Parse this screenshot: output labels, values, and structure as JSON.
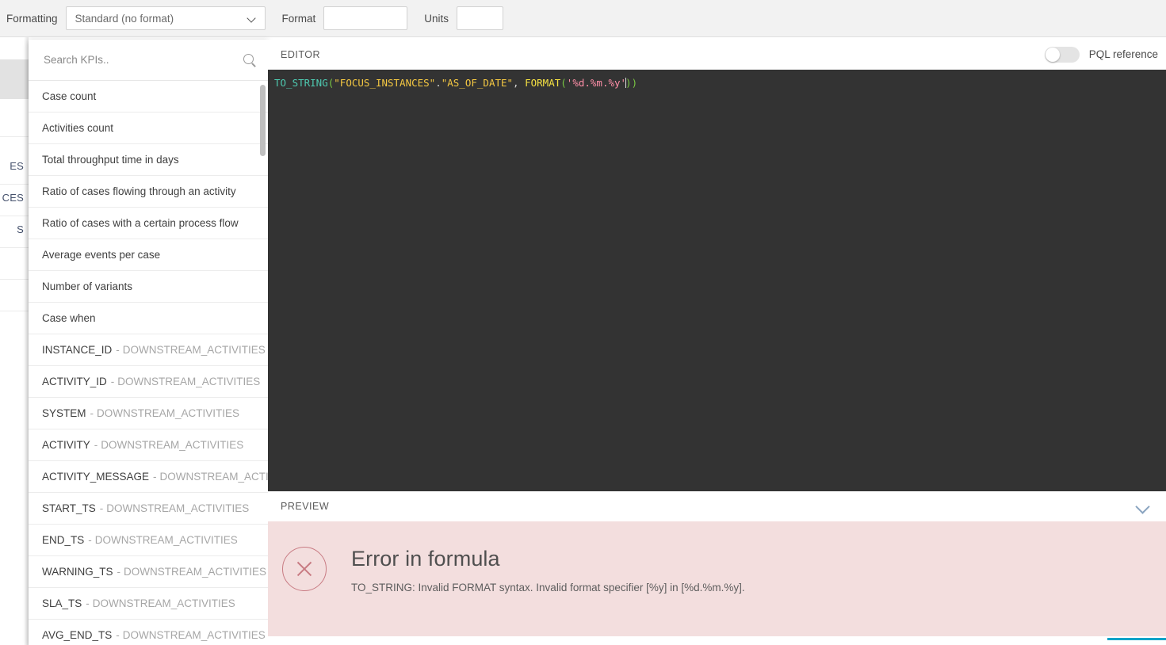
{
  "toolbar": {
    "formatting_label": "Formatting",
    "format_select_value": "Standard (no format)",
    "format_label": "Format",
    "format_value": "",
    "format_placeholder": "",
    "units_label": "Units",
    "units_value": "",
    "units_placeholder": "",
    "chevron_icon": "chevron-down-icon"
  },
  "background_fragments": [
    {
      "text": "ES"
    },
    {
      "text": "CES"
    },
    {
      "text": "S"
    }
  ],
  "kpi_panel": {
    "search_placeholder": "Search KPIs..",
    "search_value": "",
    "search_icon": "search-icon",
    "items": [
      {
        "field": "Case count",
        "table": ""
      },
      {
        "field": "Activities count",
        "table": ""
      },
      {
        "field": "Total throughput time in days",
        "table": ""
      },
      {
        "field": "Ratio of cases flowing through an activity",
        "table": ""
      },
      {
        "field": "Ratio of cases with a certain process flow",
        "table": ""
      },
      {
        "field": "Average events per case",
        "table": ""
      },
      {
        "field": "Number of variants",
        "table": ""
      },
      {
        "field": "Case when",
        "table": ""
      },
      {
        "field": "INSTANCE_ID",
        "table": "DOWNSTREAM_ACTIVITIES"
      },
      {
        "field": "ACTIVITY_ID",
        "table": "DOWNSTREAM_ACTIVITIES"
      },
      {
        "field": "SYSTEM",
        "table": "DOWNSTREAM_ACTIVITIES"
      },
      {
        "field": "ACTIVITY",
        "table": "DOWNSTREAM_ACTIVITIES"
      },
      {
        "field": "ACTIVITY_MESSAGE",
        "table": "DOWNSTREAM_ACTIVITIES"
      },
      {
        "field": "START_TS",
        "table": "DOWNSTREAM_ACTIVITIES"
      },
      {
        "field": "END_TS",
        "table": "DOWNSTREAM_ACTIVITIES"
      },
      {
        "field": "WARNING_TS",
        "table": "DOWNSTREAM_ACTIVITIES"
      },
      {
        "field": "SLA_TS",
        "table": "DOWNSTREAM_ACTIVITIES"
      },
      {
        "field": "AVG_END_TS",
        "table": "DOWNSTREAM_ACTIVITIES"
      }
    ]
  },
  "editor": {
    "title": "EDITOR",
    "pql_toggle_label": "PQL reference",
    "pql_toggle_state": "off",
    "code_text": "TO_STRING(\"FOCUS_INSTANCES\".\"AS_OF_DATE\", FORMAT('%d.%m.%y'))",
    "tokens": {
      "fn": "TO_STRING",
      "open_paren": "(",
      "arg1_table": "\"FOCUS_INSTANCES\"",
      "dot": ".",
      "arg1_column": "\"AS_OF_DATE\"",
      "comma": ", ",
      "format_kw": "FORMAT",
      "format_open": "(",
      "format_string": "'%d.%m.%y'",
      "close_parens": "))"
    },
    "colors": {
      "editor_bg": "#333333",
      "function": "#4ec9b0",
      "paren": "#7ac943",
      "string": "#f5c842",
      "keyword": "#f5e142",
      "format_literal": "#ff8fa8"
    }
  },
  "preview": {
    "title": "PREVIEW",
    "collapse_icon": "chevron-down-icon",
    "error_icon": "error-circle-x-icon",
    "error_title": "Error in formula",
    "error_message": "TO_STRING: Invalid FORMAT syntax. Invalid format specifier [%y] in [%d.%m.%y].",
    "colors": {
      "error_bg": "#f3dede",
      "error_accent": "#c87b83"
    }
  },
  "accent_color": "#0fa3c8"
}
